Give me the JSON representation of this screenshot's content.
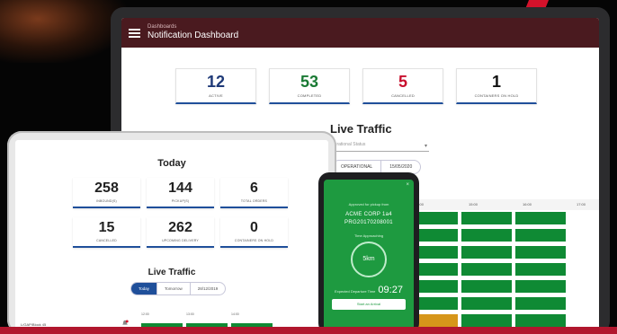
{
  "monitor": {
    "appbar": {
      "crumb": "Dashboards",
      "title": "Notification Dashboard"
    },
    "stats": [
      {
        "value": "12",
        "label": "ACTIVE",
        "color": "#1f3a78"
      },
      {
        "value": "53",
        "label": "COMPLETED",
        "color": "#1a7a34"
      },
      {
        "value": "5",
        "label": "CANCELLED",
        "color": "#c8102e"
      },
      {
        "value": "1",
        "label": "CONTAINERS ON HOLD",
        "color": "#111111"
      }
    ],
    "live_traffic_title": "Live Traffic",
    "filter_placeholder": "Operational Status",
    "pills": [
      "OPERATIONAL",
      "15/05/2020"
    ],
    "grid_headers": [
      "14:00",
      "15:00",
      "16:00",
      "17:00"
    ]
  },
  "tablet": {
    "today_title": "Today",
    "stats": [
      {
        "value": "258",
        "label": "INBOUND(S)"
      },
      {
        "value": "144",
        "label": "PICKUP(S)"
      },
      {
        "value": "6",
        "label": "TOTAL ORDERS"
      },
      {
        "value": "15",
        "label": "CANCELLED"
      },
      {
        "value": "262",
        "label": "UPCOMING DELIVERY"
      },
      {
        "value": "0",
        "label": "CONTAINERS ON HOLD"
      }
    ],
    "live_traffic_title": "Live Traffic",
    "pills": [
      {
        "label": "Today",
        "active": true
      },
      {
        "label": "Tomorrow",
        "active": false
      },
      {
        "label": "28/12/2019",
        "active": false
      }
    ],
    "row_label": "L/GAP/Block 45",
    "row_headers": [
      "12:00",
      "13:00",
      "14:00"
    ]
  },
  "phone": {
    "close": "×",
    "label": "Approved for pickup from",
    "company": "ACME CORP 1a4",
    "code": "PRG20170208001",
    "approach_label": "Time Approaching",
    "ring_value": "5km",
    "expected_label": "Expected Departure Time",
    "expected_time": "09:27",
    "button_label": "Start an Arrival"
  }
}
